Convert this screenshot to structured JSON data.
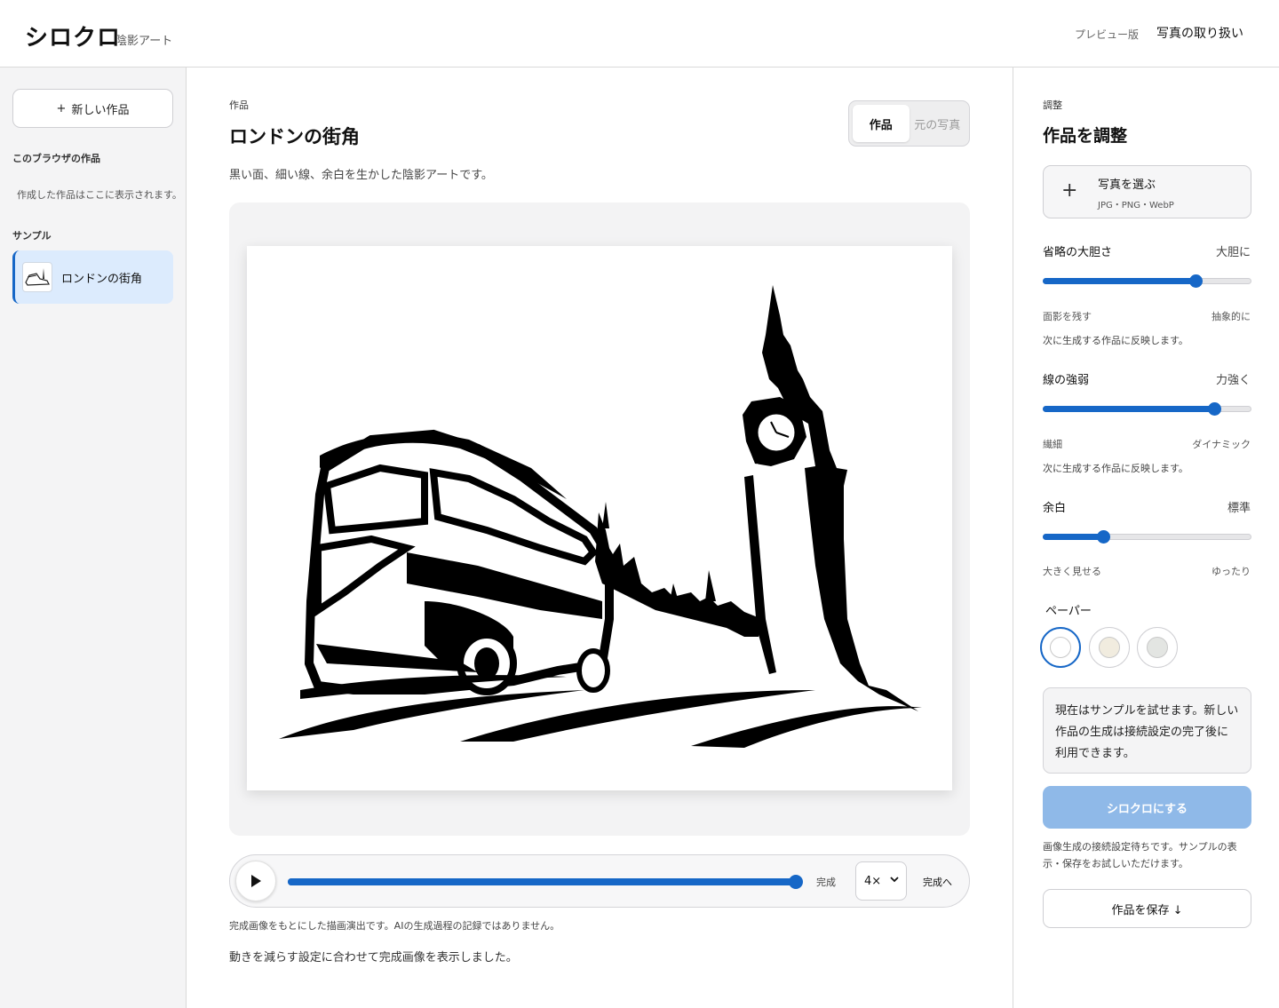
{
  "header": {
    "logo": "シロクロ",
    "logo_sub": "陰影アート",
    "preview": "プレビュー版",
    "handling": "写真の取り扱い"
  },
  "sidebar": {
    "new_button": "新しい作品",
    "new_icon": "plus-icon",
    "browser_heading": "このブラウザの作品",
    "browser_empty": "作成した作品はここに表示されます。",
    "sample_heading": "サンプル",
    "samples": [
      {
        "label": "ロンドンの街角",
        "selected": true
      }
    ]
  },
  "main": {
    "eyebrow": "作品",
    "title": "ロンドンの街角",
    "description": "黒い面、細い線、余白を生かした陰影アートです。",
    "tabs": [
      {
        "label": "作品",
        "active": true
      },
      {
        "label": "元の写真",
        "active": false
      }
    ],
    "player": {
      "play_icon": "play-icon",
      "progress": 1.0,
      "status": "完成",
      "speed": "4×",
      "to_done": "完成へ"
    },
    "note": "完成画像をもとにした描画演出です。AIの生成過程の記録ではありません。",
    "motion_note": "動きを減らす設定に合わせて完成画像を表示しました。"
  },
  "panel": {
    "eyebrow": "調整",
    "title": "作品を調整",
    "photo_button": {
      "label": "写真を選ぶ",
      "formats": "JPG・PNG・WebP"
    },
    "sliders": [
      {
        "label": "省略の大胆さ",
        "value_label": "大胆に",
        "value": 0.73,
        "min_label": "面影を残す",
        "max_label": "抽象的に",
        "hint": "次に生成する作品に反映します。"
      },
      {
        "label": "線の強弱",
        "value_label": "力強く",
        "value": 0.82,
        "min_label": "繊細",
        "max_label": "ダイナミック",
        "hint": "次に生成する作品に反映します。"
      },
      {
        "label": "余白",
        "value_label": "標準",
        "value": 0.29,
        "min_label": "大きく見せる",
        "max_label": "ゆったり",
        "hint": ""
      }
    ],
    "paper_label": "ペーパー",
    "papers": [
      {
        "name": "white",
        "color": "#ffffff",
        "selected": true
      },
      {
        "name": "cream",
        "color": "#f1ecdf",
        "selected": false
      },
      {
        "name": "gray",
        "color": "#e3e5e2",
        "selected": false
      }
    ],
    "info": "現在はサンプルを試せます。新しい作品の生成は接続設定の完了後に利用できます。",
    "cta": "シロクロにする",
    "cta_note": "画像生成の接続設定待ちです。サンプルの表示・保存をお試しいただけます。",
    "save_button": "作品を保存 ↓"
  },
  "colors": {
    "accent": "#1667c7",
    "cta_disabled": "#8fb9e8",
    "selected_bg": "#dcebfd"
  }
}
